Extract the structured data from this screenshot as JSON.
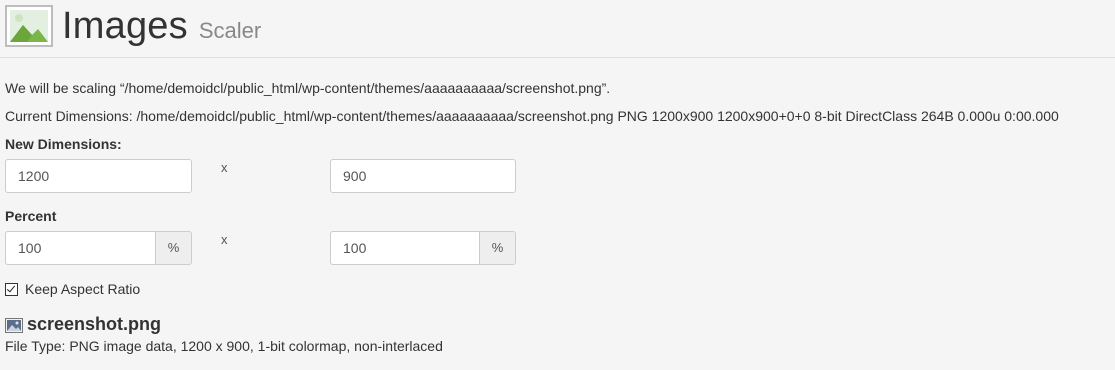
{
  "header": {
    "title": "Images",
    "subtitle": "Scaler",
    "icon": "image-icon"
  },
  "info": {
    "scaling_text": "We will be scaling “/home/demoidcl/public_html/wp-content/themes/aaaaaaaaaa/screenshot.png”.",
    "current_dimensions": "Current Dimensions: /home/demoidcl/public_html/wp-content/themes/aaaaaaaaaa/screenshot.png PNG 1200x900 1200x900+0+0 8-bit DirectClass 264B 0.000u 0:00.000"
  },
  "new_dimensions": {
    "label": "New Dimensions:",
    "width": "1200",
    "height": "900",
    "separator": "x"
  },
  "percent": {
    "label": "Percent",
    "width": "100",
    "height": "100",
    "unit": "%",
    "separator": "x"
  },
  "aspect": {
    "label": "Keep Aspect Ratio",
    "checked": true
  },
  "file": {
    "icon": "image-file-icon",
    "name": "screenshot.png",
    "type_text": "File Type: PNG image data, 1200 x 900, 1-bit colormap, non-interlaced"
  },
  "colors": {
    "background": "#f5f5f5",
    "icon_green": "#7ab648",
    "icon_frame": "#c8c8c8"
  }
}
